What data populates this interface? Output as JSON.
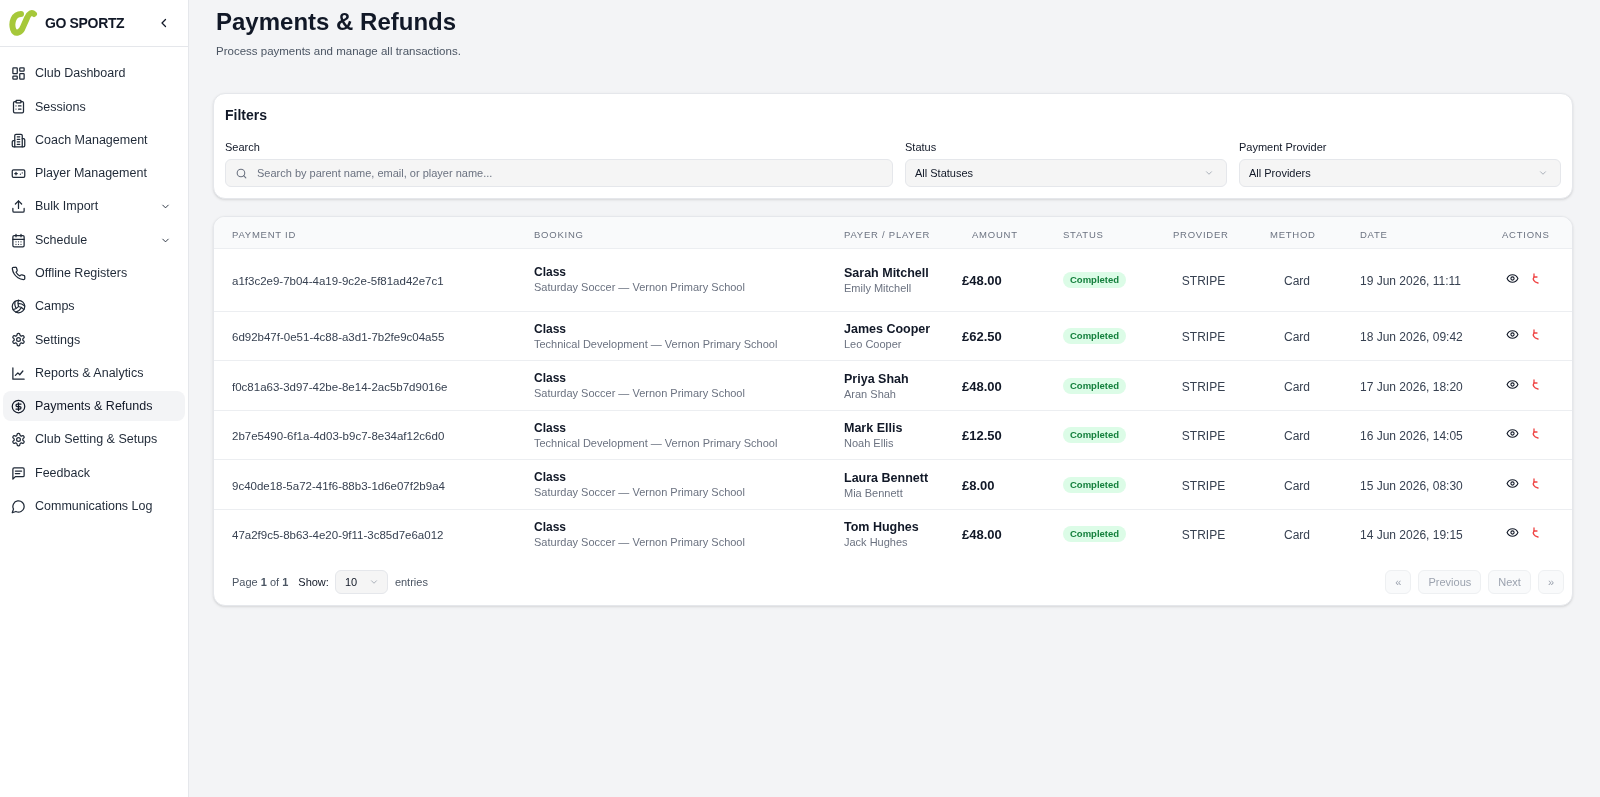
{
  "sidebar": {
    "brand": "GO SPORTZ",
    "items": [
      {
        "label": "Club Dashboard",
        "selected": false,
        "expandable": false
      },
      {
        "label": "Sessions",
        "selected": false,
        "expandable": false
      },
      {
        "label": "Coach Management",
        "selected": false,
        "expandable": false
      },
      {
        "label": "Player Management",
        "selected": false,
        "expandable": false
      },
      {
        "label": "Bulk Import",
        "selected": false,
        "expandable": true
      },
      {
        "label": "Schedule",
        "selected": false,
        "expandable": true
      },
      {
        "label": "Offline Registers",
        "selected": false,
        "expandable": false
      },
      {
        "label": "Camps",
        "selected": false,
        "expandable": false
      },
      {
        "label": "Settings",
        "selected": false,
        "expandable": false
      },
      {
        "label": "Reports & Analytics",
        "selected": false,
        "expandable": false
      },
      {
        "label": "Payments & Refunds",
        "selected": true,
        "expandable": false
      },
      {
        "label": "Club Setting & Setups",
        "selected": false,
        "expandable": false
      },
      {
        "label": "Feedback",
        "selected": false,
        "expandable": false
      },
      {
        "label": "Communications Log",
        "selected": false,
        "expandable": false
      }
    ]
  },
  "header": {
    "title": "Payments & Refunds",
    "subtitle": "Process payments and manage all transactions."
  },
  "filters": {
    "title": "Filters",
    "search": {
      "label": "Search",
      "placeholder": "Search by parent name, email, or player name..."
    },
    "status": {
      "label": "Status",
      "value": "All Statuses"
    },
    "provider": {
      "label": "Payment Provider",
      "value": "All Providers"
    }
  },
  "table": {
    "columns": [
      "PAYMENT ID",
      "BOOKING",
      "PAYER / PLAYER",
      "AMOUNT",
      "STATUS",
      "PROVIDER",
      "METHOD",
      "DATE",
      "ACTIONS"
    ],
    "rows": [
      {
        "payment_id": "a1f3c2e9-7b04-4a19-9c2e-5f81ad42e7c1",
        "booking_type": "Class",
        "booking_detail": "Saturday Soccer — Vernon Primary School",
        "payer": "Sarah Mitchell",
        "player": "Emily Mitchell",
        "amount": "£48.00",
        "status": "Completed",
        "provider": "STRIPE",
        "method": "Card",
        "date": "19 Jun 2026, 11:11"
      },
      {
        "payment_id": "6d92b47f-0e51-4c88-a3d1-7b2fe9c04a55",
        "booking_type": "Class",
        "booking_detail": "Technical Development — Vernon Primary School",
        "payer": "James Cooper",
        "player": "Leo Cooper",
        "amount": "£62.50",
        "status": "Completed",
        "provider": "STRIPE",
        "method": "Card",
        "date": "18 Jun 2026, 09:42"
      },
      {
        "payment_id": "f0c81a63-3d97-42be-8e14-2ac5b7d9016e",
        "booking_type": "Class",
        "booking_detail": "Saturday Soccer — Vernon Primary School",
        "payer": "Priya Shah",
        "player": "Aran Shah",
        "amount": "£48.00",
        "status": "Completed",
        "provider": "STRIPE",
        "method": "Card",
        "date": "17 Jun 2026, 18:20"
      },
      {
        "payment_id": "2b7e5490-6f1a-4d03-b9c7-8e34af12c6d0",
        "booking_type": "Class",
        "booking_detail": "Technical Development — Vernon Primary School",
        "payer": "Mark Ellis",
        "player": "Noah Ellis",
        "amount": "£12.50",
        "status": "Completed",
        "provider": "STRIPE",
        "method": "Card",
        "date": "16 Jun 2026, 14:05"
      },
      {
        "payment_id": "9c40de18-5a72-41f6-88b3-1d6e07f2b9a4",
        "booking_type": "Class",
        "booking_detail": "Saturday Soccer — Vernon Primary School",
        "payer": "Laura Bennett",
        "player": "Mia Bennett",
        "amount": "£8.00",
        "status": "Completed",
        "provider": "STRIPE",
        "method": "Card",
        "date": "15 Jun 2026, 08:30"
      },
      {
        "payment_id": "47a2f9c5-8b63-4e20-9f11-3c85d7e6a012",
        "booking_type": "Class",
        "booking_detail": "Saturday Soccer — Vernon Primary School",
        "payer": "Tom Hughes",
        "player": "Jack Hughes",
        "amount": "£48.00",
        "status": "Completed",
        "provider": "STRIPE",
        "method": "Card",
        "date": "14 Jun 2026, 19:15"
      }
    ]
  },
  "pagination": {
    "page_text": "Page **1** of **1**",
    "show_label": "Show:",
    "page_size": "10",
    "entries_label": "entries",
    "buttons": [
      {
        "label": "«",
        "disabled": true
      },
      {
        "label": "Previous",
        "disabled": true
      },
      {
        "label": "Next",
        "disabled": true
      },
      {
        "label": "»",
        "disabled": true
      }
    ]
  }
}
